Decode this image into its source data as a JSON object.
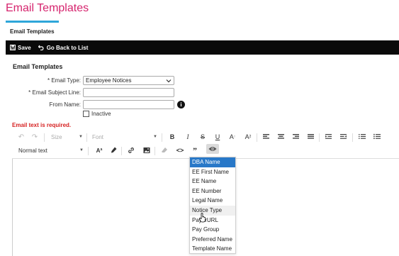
{
  "page": {
    "title": "Email Templates",
    "tab": "Email Templates"
  },
  "toolbar": {
    "save_label": "Save",
    "back_label": "Go Back to List"
  },
  "form": {
    "section_title": "Email Templates",
    "email_type_label": "Email Type:",
    "email_type_value": "Employee Notices",
    "subject_label": "Email Subject Line:",
    "from_name_label": "From Name:",
    "inactive_label": "Inactive",
    "required_marker": "*",
    "info_glyph": "i",
    "error": "Email text is required."
  },
  "editor": {
    "undo_glyph": "↶",
    "redo_glyph": "↷",
    "size_label": "Size",
    "font_label": "Font",
    "bold_glyph": "B",
    "italic_glyph": "I",
    "strike_glyph": "S",
    "underline_glyph": "U",
    "superscript_glyph": "A",
    "subscript_glyph": "A",
    "sup_mark": "↑",
    "sub_mark": "2",
    "paragraph_label": "Normal text",
    "font_size_glyph": "Aª",
    "code_glyph": "<>",
    "quote_glyph": "”"
  },
  "placeholder_menu": {
    "items": [
      "DBA Name",
      "EE First Name",
      "EE Name",
      "EE Number",
      "Legal Name",
      "Notice Type",
      "PayerURL",
      "Pay Group",
      "Preferred Name",
      "Template Name"
    ],
    "selected_index": 0,
    "hover_index": 5
  },
  "colors": {
    "title": "#d6246e",
    "underline": "#2ea6d9",
    "error": "#d62222",
    "selected": "#2878c8"
  }
}
